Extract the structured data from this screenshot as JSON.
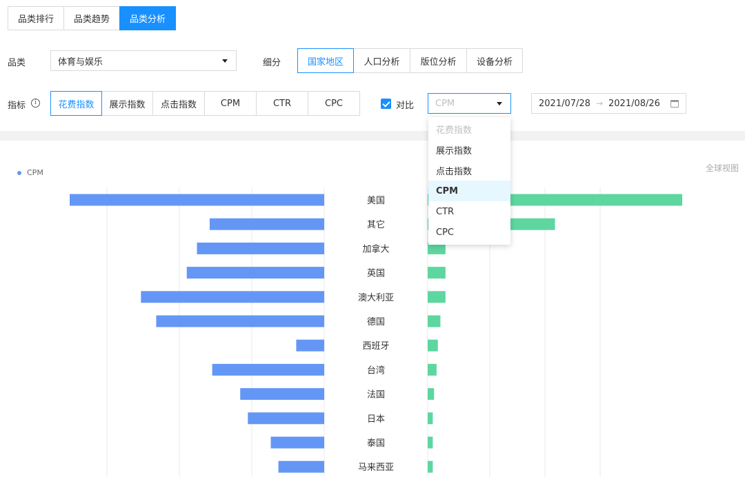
{
  "tabs": [
    {
      "label": "品类排行",
      "active": false
    },
    {
      "label": "品类趋势",
      "active": false
    },
    {
      "label": "品类分析",
      "active": true
    }
  ],
  "filters": {
    "category_label": "品类",
    "category_value": "体育与娱乐",
    "segment_label": "细分",
    "segments": [
      "国家地区",
      "人口分析",
      "版位分析",
      "设备分析"
    ],
    "segment_active": "国家地区",
    "metric_label": "指标",
    "metrics": [
      "花费指数",
      "展示指数",
      "点击指数",
      "CPM",
      "CTR",
      "CPC"
    ],
    "metric_active": "花费指数",
    "compare_label": "对比",
    "compare_checked": true,
    "compare_value": "CPM",
    "date_start": "2021/07/28",
    "date_sep": "→",
    "date_end": "2021/08/26"
  },
  "dropdown": {
    "options": [
      "花费指数",
      "展示指数",
      "点击指数",
      "CPM",
      "CTR",
      "CPC"
    ],
    "disabled": "花费指数",
    "selected": "CPM"
  },
  "chart_labels": {
    "legend": "CPM",
    "view": "全球视图"
  },
  "colors": {
    "accent": "#1890ff",
    "left_bar": "#6497f5",
    "right_bar": "#5ed6a0"
  },
  "chart_data": {
    "type": "bar",
    "categories": [
      "美国",
      "其它",
      "加拿大",
      "英国",
      "澳大利亚",
      "德国",
      "西班牙",
      "台湾",
      "法国",
      "日本",
      "泰国",
      "马来西亚"
    ],
    "series": [
      {
        "name": "花费指数",
        "values": [
          100,
          45,
          50,
          54,
          72,
          66,
          11,
          44,
          33,
          30,
          21,
          18
        ]
      },
      {
        "name": "CPM",
        "values": [
          100,
          50,
          7,
          7,
          7,
          5,
          4,
          3.5,
          2.5,
          2,
          2,
          2
        ]
      }
    ]
  }
}
